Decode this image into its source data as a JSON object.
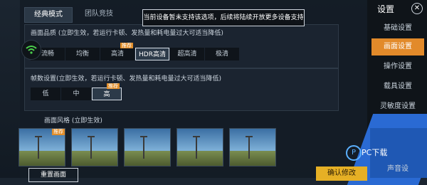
{
  "tabs": [
    {
      "label": "经典模式",
      "active": true
    },
    {
      "label": "团队竞技",
      "active": false
    }
  ],
  "tooltip": "当前设备暂未支持该选项，后续将陆续开放更多设备支持",
  "quality": {
    "title": "画面品质 (立即生效，若运行卡顿、发热量和耗电量过大可适当降低)",
    "options": [
      "流畅",
      "均衡",
      "高清",
      "HDR高清",
      "超高清",
      "极清"
    ],
    "selected": "HDR高清",
    "recommended_badge": "推荐"
  },
  "frame": {
    "title": "帧数设置(立即生效，若运行卡顿、发热量和耗电量过大可适当降低)",
    "options": [
      "低",
      "中",
      "高"
    ],
    "selected": "高",
    "recommended_badge": "推荐"
  },
  "style": {
    "title": "画面风格 (立即生效)",
    "recommended_badge": "推荐"
  },
  "right_panel": {
    "title": "设置",
    "items": [
      "基础设置",
      "画面设置",
      "操作设置",
      "载具设置",
      "灵敏度设置",
      "声音设"
    ],
    "active": "画面设置"
  },
  "bottom": {
    "reset_label": "重置画面",
    "confirm_label": "确认修改"
  },
  "watermark": {
    "text": "PC下载"
  }
}
